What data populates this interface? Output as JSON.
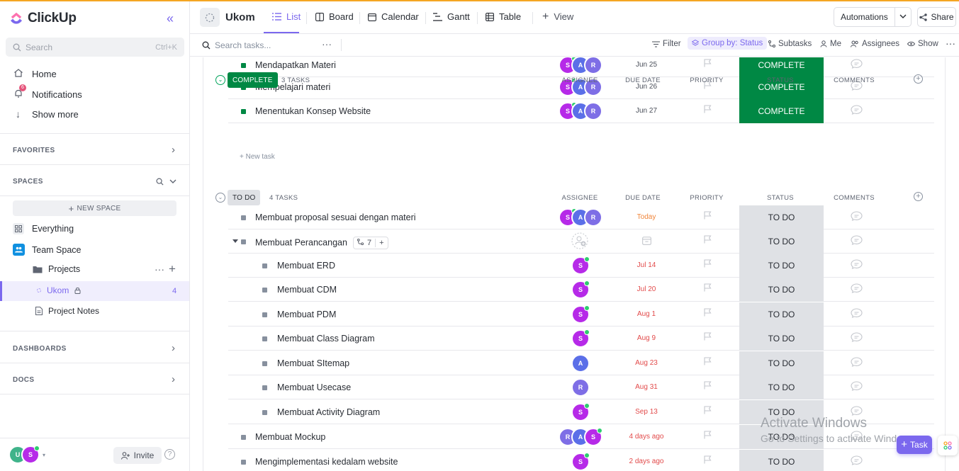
{
  "app": {
    "name": "ClickUp"
  },
  "sidebar": {
    "search_placeholder": "Search",
    "search_shortcut": "Ctrl+K",
    "nav": [
      {
        "label": "Home"
      },
      {
        "label": "Notifications",
        "badge": "6"
      },
      {
        "label": "Show more"
      }
    ],
    "favorites_title": "FAVORITES",
    "spaces_title": "SPACES",
    "new_space_label": "NEW SPACE",
    "everything_label": "Everything",
    "team_space_label": "Team Space",
    "projects_label": "Projects",
    "ukom_label": "Ukom",
    "ukom_count": "4",
    "project_notes_label": "Project Notes",
    "dashboards_title": "DASHBOARDS",
    "docs_title": "DOCS",
    "user_avatars": [
      "U",
      "S"
    ],
    "invite_label": "Invite",
    "help_label": "?"
  },
  "header": {
    "title": "Ukom",
    "tabs": [
      {
        "label": "List",
        "active": true
      },
      {
        "label": "Board"
      },
      {
        "label": "Calendar"
      },
      {
        "label": "Gantt"
      },
      {
        "label": "Table"
      },
      {
        "label": "View"
      }
    ],
    "automations_label": "Automations",
    "share_label": "Share"
  },
  "toolbar": {
    "search_placeholder": "Search tasks...",
    "filter_label": "Filter",
    "groupby_label": "Group by: Status",
    "subtasks_label": "Subtasks",
    "me_label": "Me",
    "assignees_label": "Assignees",
    "show_label": "Show"
  },
  "columns": {
    "assignee": "ASSIGNEE",
    "due_date": "DUE DATE",
    "priority": "PRIORITY",
    "status": "STATUS",
    "comments": "COMMENTS"
  },
  "colors": {
    "accent": "#7b68ee",
    "complete": "#008844",
    "todo_bg": "#dfe1e5",
    "overdue": "#e24a4a",
    "today": "#f0853a",
    "avatar_s": "#b62ae8",
    "avatar_a": "#5b6fe8",
    "avatar_r": "#7e6ee6",
    "avatar_u": "#3fb38a"
  },
  "groups": {
    "complete": {
      "label": "COMPLETE",
      "count": "3 TASKS",
      "new_task": "+ New task",
      "tasks": [
        {
          "name": "Mendapatkan Materi",
          "due": "Jun 25",
          "status": "COMPLETE"
        },
        {
          "name": "Mempelajari materi",
          "due": "Jun 26",
          "status": "COMPLETE"
        },
        {
          "name": "Menentukan Konsep Website",
          "due": "Jun 27",
          "status": "COMPLETE"
        }
      ]
    },
    "todo": {
      "label": "TO DO",
      "count": "4 TASKS",
      "tasks": [
        {
          "name": "Membuat proposal sesuai dengan materi",
          "due": "Today",
          "status": "TO DO"
        },
        {
          "name": "Membuat Perancangan",
          "subtask_count": "7",
          "subtask_add": "+",
          "status": "TO DO"
        },
        {
          "name": "Membuat ERD",
          "due": "Jul 14",
          "status": "TO DO"
        },
        {
          "name": "Membuat CDM",
          "due": "Jul 20",
          "status": "TO DO"
        },
        {
          "name": "Membuat PDM",
          "due": "Aug 1",
          "status": "TO DO"
        },
        {
          "name": "Membuat Class Diagram",
          "due": "Aug 9",
          "status": "TO DO"
        },
        {
          "name": "Membuat SItemap",
          "due": "Aug 23",
          "status": "TO DO"
        },
        {
          "name": "Membuat Usecase",
          "due": "Aug 31",
          "status": "TO DO"
        },
        {
          "name": "Membuat Activity Diagram",
          "due": "Sep 13",
          "status": "TO DO"
        },
        {
          "name": "Membuat Mockup",
          "due": "4 days ago",
          "status": "TO DO"
        },
        {
          "name": "Mengimplementasi kedalam website",
          "due": "2 days ago",
          "status": "TO DO"
        }
      ]
    }
  },
  "assignee_initials": {
    "s": "S",
    "a": "A",
    "r": "R"
  },
  "watermark": {
    "line1": "Activate Windows",
    "line2": "Go to Settings to activate Windows."
  },
  "fab": {
    "task_label": "Task"
  }
}
